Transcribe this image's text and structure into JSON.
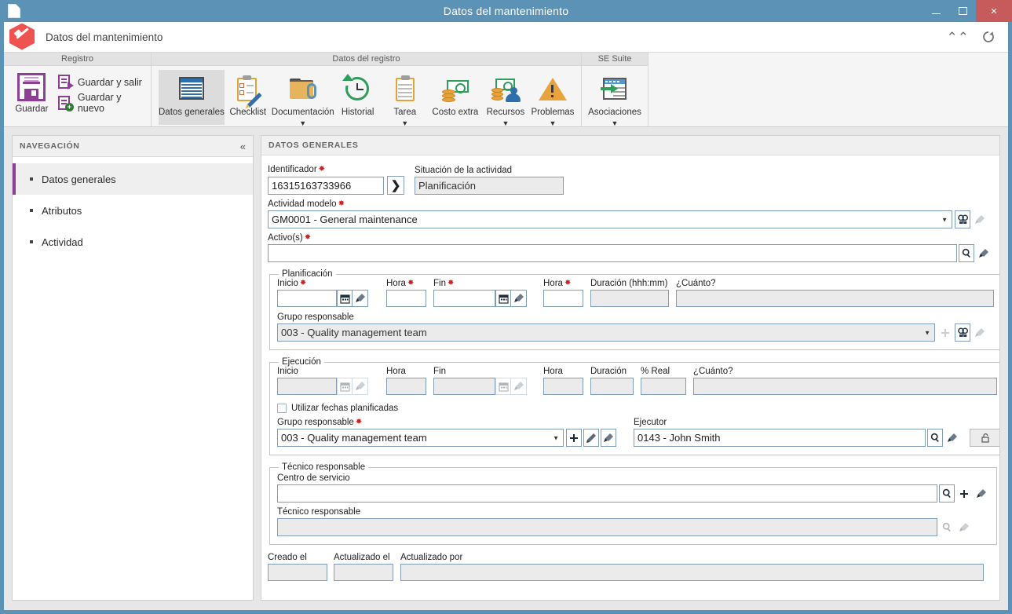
{
  "window": {
    "title": "Datos del mantenimiento",
    "minimize_label": "Minimizar",
    "maximize_label": "Maximizar",
    "close_label": "×"
  },
  "app_header": {
    "title": "Datos del mantenimiento"
  },
  "ribbon": {
    "groups": [
      {
        "title": "Registro",
        "big_button": {
          "label": "Guardar",
          "icon": "save-icon"
        },
        "small_buttons": [
          {
            "label": "Guardar y salir",
            "icon": "save-exit-icon"
          },
          {
            "label": "Guardar y nuevo",
            "icon": "save-new-icon"
          }
        ]
      },
      {
        "title": "Datos del registro",
        "buttons": [
          {
            "label": "Datos generales",
            "icon": "general-data-icon",
            "caret": false,
            "active": true
          },
          {
            "label": "Checklist",
            "icon": "checklist-icon",
            "caret": false,
            "active": false
          },
          {
            "label": "Documentación",
            "icon": "documentation-icon",
            "caret": true,
            "active": false
          },
          {
            "label": "Historial",
            "icon": "history-icon",
            "caret": false,
            "active": false
          },
          {
            "label": "Tarea",
            "icon": "task-icon",
            "caret": true,
            "active": false
          },
          {
            "label": "Costo extra",
            "icon": "extra-cost-icon",
            "caret": false,
            "active": false
          },
          {
            "label": "Recursos",
            "icon": "resources-icon",
            "caret": true,
            "active": false
          },
          {
            "label": "Problemas",
            "icon": "problems-icon",
            "caret": true,
            "active": false
          }
        ]
      },
      {
        "title": "SE Suite",
        "buttons": [
          {
            "label": "Asociaciones",
            "icon": "associations-icon",
            "caret": true,
            "active": false
          }
        ]
      }
    ]
  },
  "sidebar": {
    "title": "NAVEGACIÓN",
    "collapse_icon": "«",
    "items": [
      {
        "label": "Datos generales",
        "active": true
      },
      {
        "label": "Atributos",
        "active": false
      },
      {
        "label": "Actividad",
        "active": false
      }
    ]
  },
  "content": {
    "section_title": "DATOS GENERALES",
    "identificador": {
      "label": "Identificador",
      "required": true,
      "value": "16315163733966"
    },
    "goto_button": "❯",
    "situacion": {
      "label": "Situación de la actividad",
      "required": false,
      "value": "Planificación"
    },
    "actividad_modelo": {
      "label": "Actividad modelo",
      "required": true,
      "value": "GM0001 - General maintenance"
    },
    "activos": {
      "label": "Activo(s)",
      "required": true,
      "value": ""
    },
    "planificacion": {
      "legend": "Planificación",
      "inicio": {
        "label": "Inicio",
        "required": true,
        "value": ""
      },
      "hora_inicio": {
        "label": "Hora",
        "required": true,
        "value": ""
      },
      "fin": {
        "label": "Fin",
        "required": true,
        "value": ""
      },
      "hora_fin": {
        "label": "Hora",
        "required": true,
        "value": ""
      },
      "duracion": {
        "label": "Duración (hhh:mm)",
        "required": false,
        "value": ""
      },
      "cuanto": {
        "label": "¿Cuánto?",
        "required": false,
        "value": ""
      },
      "grupo_responsable": {
        "label": "Grupo responsable",
        "required": false,
        "value": "003 - Quality management team"
      }
    },
    "ejecucion": {
      "legend": "Ejecución",
      "inicio": {
        "label": "Inicio",
        "required": false,
        "value": ""
      },
      "hora_inicio": {
        "label": "Hora",
        "required": false,
        "value": ""
      },
      "fin": {
        "label": "Fin",
        "required": false,
        "value": ""
      },
      "hora_fin": {
        "label": "Hora",
        "required": false,
        "value": ""
      },
      "duracion": {
        "label": "Duración",
        "required": false,
        "value": ""
      },
      "pct_real": {
        "label": "% Real",
        "required": false,
        "value": ""
      },
      "cuanto": {
        "label": "¿Cuánto?",
        "required": false,
        "value": ""
      },
      "usar_fechas": {
        "label": "Utilizar fechas planificadas",
        "checked": false
      },
      "grupo_responsable": {
        "label": "Grupo responsable",
        "required": true,
        "value": "003 - Quality management team"
      },
      "ejecutor": {
        "label": "Ejecutor",
        "required": false,
        "value": "0143 - John Smith"
      }
    },
    "tecnico": {
      "legend": "Técnico responsable",
      "centro_servicio": {
        "label": "Centro de servicio",
        "required": false,
        "value": ""
      },
      "tecnico_responsable": {
        "label": "Técnico responsable",
        "required": false,
        "value": ""
      }
    },
    "footer": {
      "creado_el": {
        "label": "Creado el",
        "value": ""
      },
      "actualizado_el": {
        "label": "Actualizado el",
        "value": ""
      },
      "actualizado_por": {
        "label": "Actualizado por",
        "value": ""
      }
    }
  },
  "colors": {
    "titlebar": "#5b92b5",
    "close_button": "#c75b5b",
    "accent_purple": "#8c3f94",
    "required_red": "#cc2222",
    "field_border": "#7f9db9",
    "readonly_bg": "#ebebeb"
  }
}
